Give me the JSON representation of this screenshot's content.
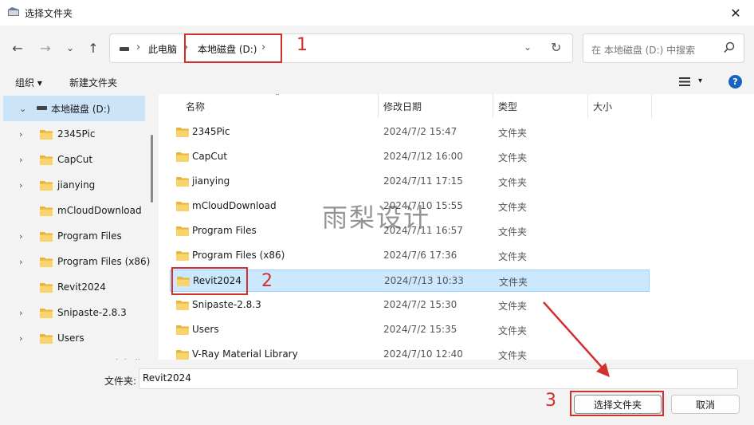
{
  "window": {
    "title": "选择文件夹",
    "close_glyph": "✕"
  },
  "nav": {
    "back_glyph": "←",
    "forward_glyph": "→",
    "recent_glyph": "⌄",
    "up_glyph": "↑",
    "breadcrumb": [
      "此电脑",
      "本地磁盘 (D:)"
    ],
    "sep_glyph": "›",
    "dropdown_glyph": "⌄",
    "refresh_glyph": "↻",
    "search_placeholder": "在 本地磁盘 (D:) 中搜索"
  },
  "toolbar": {
    "organize": "组织 ▾",
    "new_folder": "新建文件夹",
    "view_glyph": "▾",
    "help_glyph": "?"
  },
  "sidebar": {
    "items": [
      {
        "label": "本地磁盘 (D:)",
        "chevron": "⌄",
        "selected": true,
        "drive": true
      },
      {
        "label": "2345Pic",
        "chevron": "›"
      },
      {
        "label": "CapCut",
        "chevron": "›"
      },
      {
        "label": "jianying",
        "chevron": "›"
      },
      {
        "label": "mCloudDownload",
        "chevron": ""
      },
      {
        "label": "Program Files",
        "chevron": "›"
      },
      {
        "label": "Program Files (x86)",
        "chevron": "›"
      },
      {
        "label": "Revit2024",
        "chevron": ""
      },
      {
        "label": "Snipaste-2.8.3",
        "chevron": "›"
      },
      {
        "label": "Users",
        "chevron": "›"
      },
      {
        "label": "V-Ray Material Library",
        "chevron": "›"
      }
    ]
  },
  "list": {
    "columns": {
      "name": "名称",
      "modified": "修改日期",
      "type": "类型",
      "size": "大小"
    },
    "sort_glyph": "⌃",
    "rows": [
      {
        "name": "2345Pic",
        "modified": "2024/7/2 15:47",
        "type": "文件夹"
      },
      {
        "name": "CapCut",
        "modified": "2024/7/12 16:00",
        "type": "文件夹"
      },
      {
        "name": "jianying",
        "modified": "2024/7/11 17:15",
        "type": "文件夹"
      },
      {
        "name": "mCloudDownload",
        "modified": "2024/7/10 15:55",
        "type": "文件夹"
      },
      {
        "name": "Program Files",
        "modified": "2024/7/11 16:57",
        "type": "文件夹"
      },
      {
        "name": "Program Files (x86)",
        "modified": "2024/7/6 17:36",
        "type": "文件夹"
      },
      {
        "name": "Revit2024",
        "modified": "2024/7/13 10:33",
        "type": "文件夹",
        "selected": true
      },
      {
        "name": "Snipaste-2.8.3",
        "modified": "2024/7/2 15:30",
        "type": "文件夹"
      },
      {
        "name": "Users",
        "modified": "2024/7/2 15:35",
        "type": "文件夹"
      },
      {
        "name": "V-Ray Material Library",
        "modified": "2024/7/10 12:40",
        "type": "文件夹"
      }
    ]
  },
  "footer": {
    "folder_label": "文件夹:",
    "folder_value": "Revit2024",
    "select_button": "选择文件夹",
    "cancel_button": "取消"
  },
  "watermark": "雨梨设计",
  "annotations": {
    "n1": "1",
    "n2": "2",
    "n3": "3",
    "color": "#d32f2f"
  }
}
